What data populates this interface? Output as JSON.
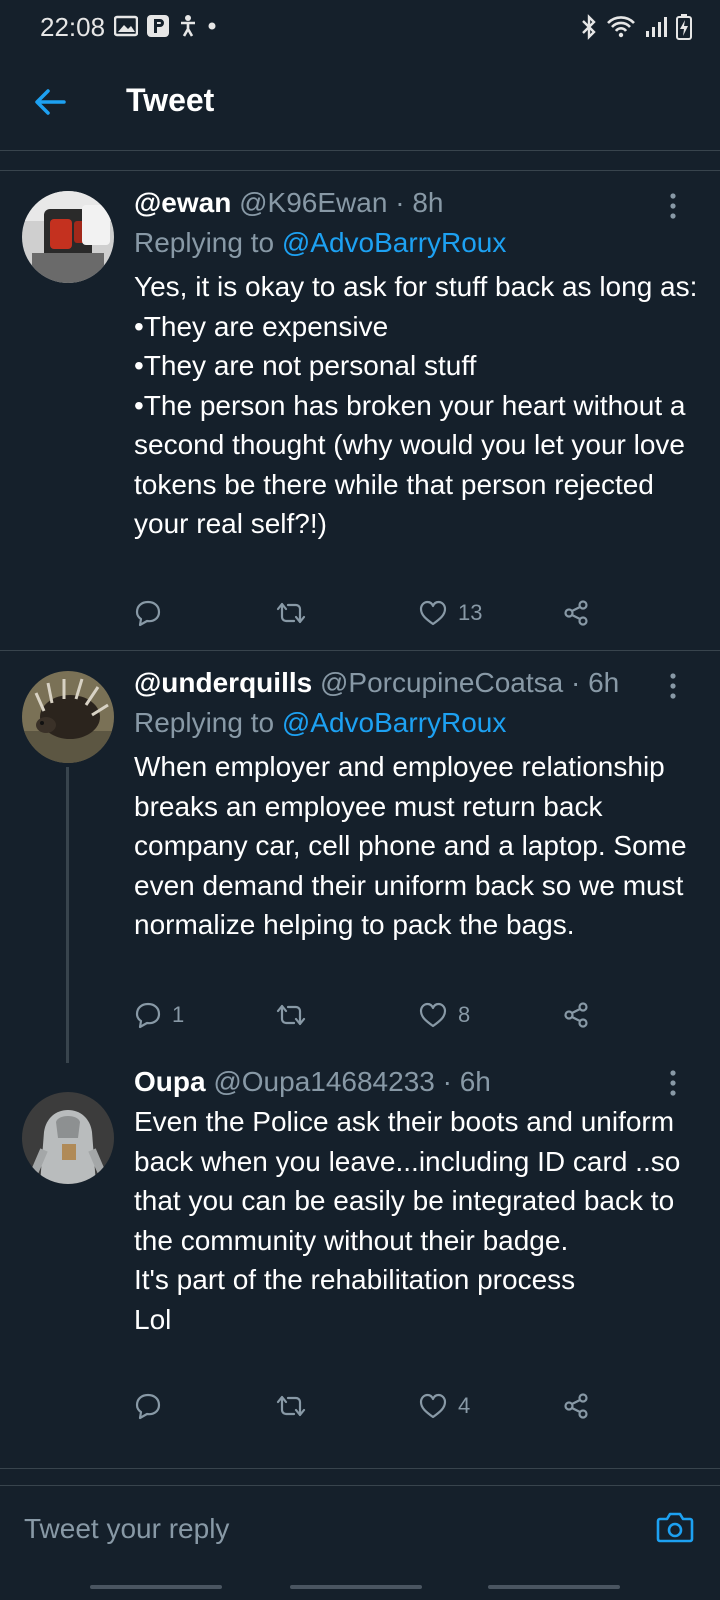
{
  "status_bar": {
    "time": "22:08",
    "left_icons": [
      "gallery-icon",
      "app-p-icon",
      "accessibility-icon",
      "dot-icon"
    ],
    "right_icons": [
      "bluetooth-icon",
      "wifi-icon",
      "signal-icon",
      "battery-icon"
    ]
  },
  "header": {
    "title": "Tweet",
    "back_icon": "arrow-left-icon"
  },
  "colors": {
    "background": "#15202b",
    "accent": "#1da1f2",
    "muted": "#8899a6",
    "divider": "#38444d"
  },
  "tweets": [
    {
      "name": "@ewan",
      "handle": "@K96Ewan",
      "separator": "·",
      "age": "8h",
      "replying_prefix": "Replying to",
      "replying_to": "@AdvoBarryRoux",
      "body": "Yes, it is okay to ask for stuff back as long as:\n•They are expensive\n•They are not personal stuff\n•The person has broken your heart without a second thought (why would you let your love tokens be there while that person rejected your real self?!)",
      "replies": "",
      "retweets": "",
      "likes": "13"
    },
    {
      "name": "@underquills",
      "handle": "@PorcupineCoatsa",
      "separator": "·",
      "age": "6h",
      "replying_prefix": "Replying to",
      "replying_to": "@AdvoBarryRoux",
      "body": "When employer and employee relationship breaks an employee must return back company car, cell phone and a laptop. Some even demand their uniform back so we must normalize helping to pack the bags.",
      "replies": "1",
      "retweets": "",
      "likes": "8"
    },
    {
      "name": "Oupa",
      "handle": "@Oupa14684233",
      "separator": "·",
      "age": "6h",
      "body": "Even the Police ask their boots and uniform  back when you leave...including ID card ..so that you can be easily be integrated back to the community without their badge.\nIt's part of the rehabilitation process\nLol",
      "replies": "",
      "retweets": "",
      "likes": "4"
    }
  ],
  "reply_bar": {
    "placeholder": "Tweet your reply",
    "camera_icon": "camera-icon"
  }
}
